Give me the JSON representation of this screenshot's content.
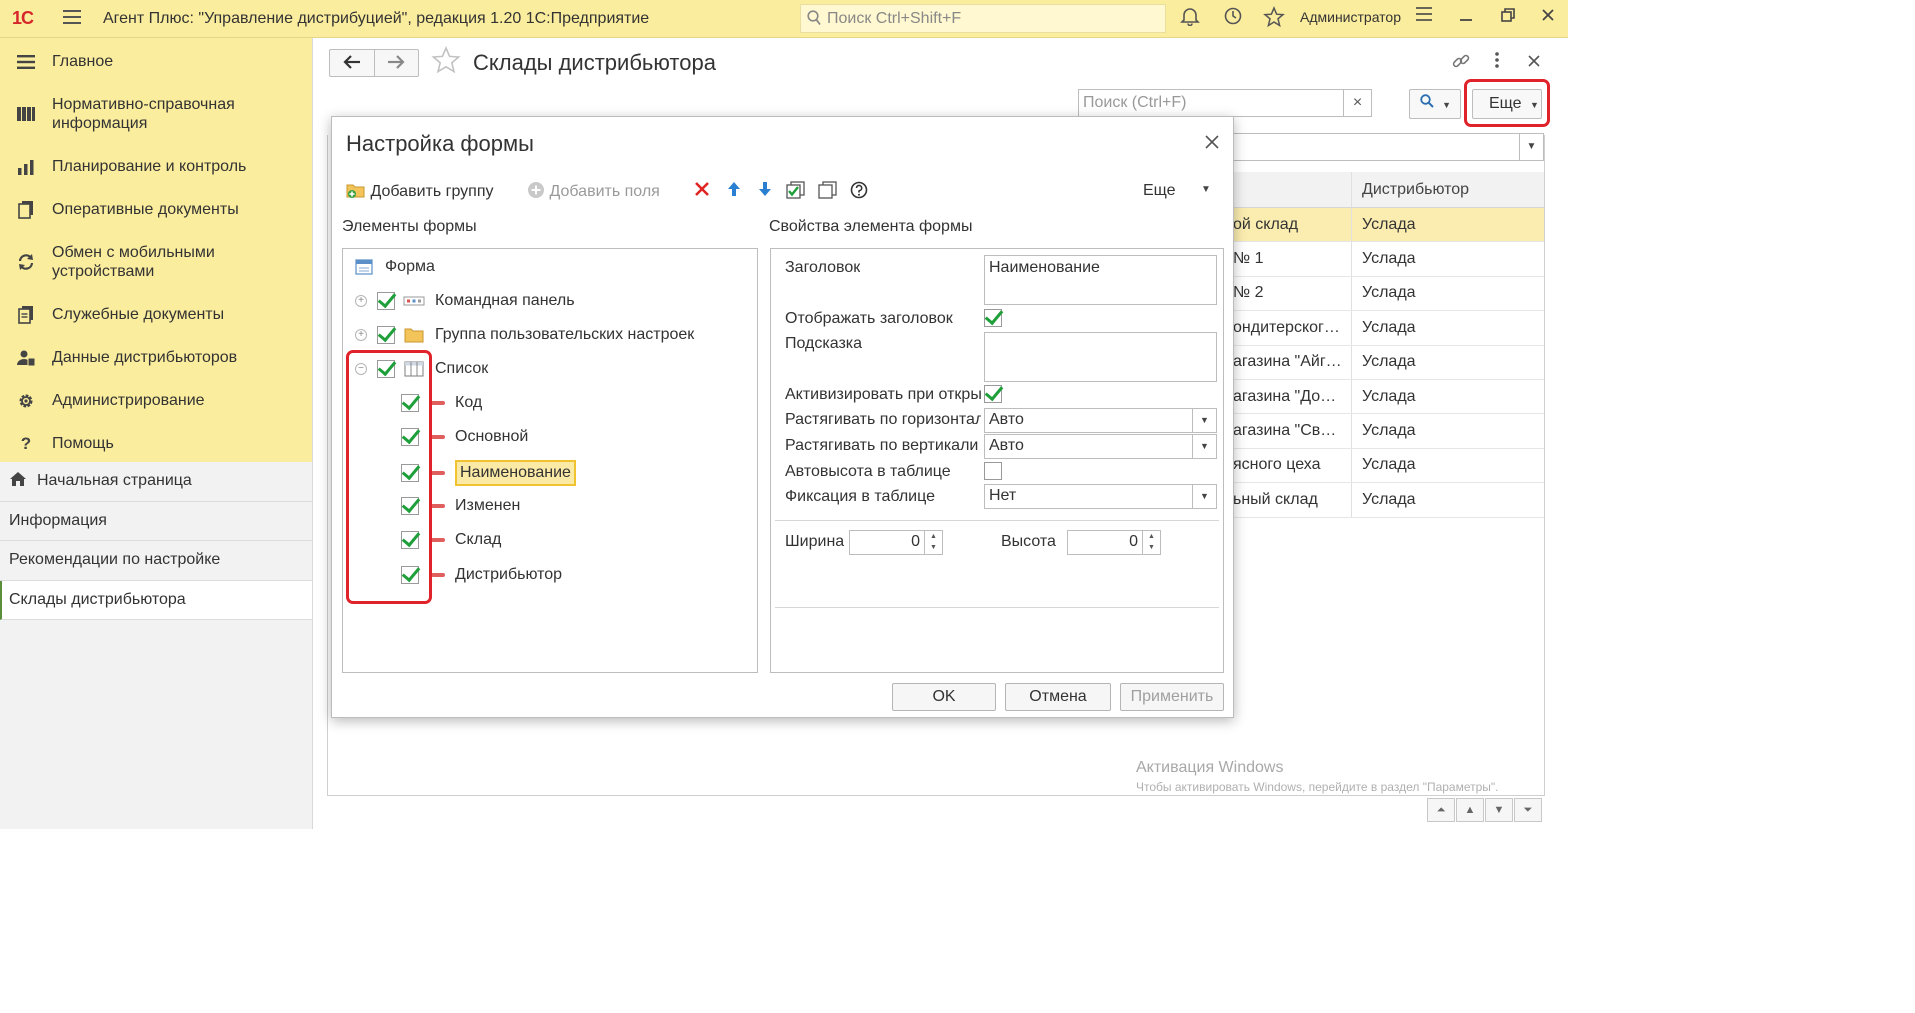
{
  "app": {
    "logo": "1С",
    "title": "Агент Плюс: \"Управление дистрибуцией\", редакция 1.20 1С:Предприятие",
    "search_placeholder": "Поиск Ctrl+Shift+F",
    "user": "Администратор"
  },
  "sections": [
    {
      "label": "Главное",
      "icon": "hamburger-icon"
    },
    {
      "label": "Нормативно-справочная информация",
      "icon": "catalog-icon"
    },
    {
      "label": "Планирование и контроль",
      "icon": "chart-icon"
    },
    {
      "label": "Оперативные документы",
      "icon": "documents-icon"
    },
    {
      "label": "Обмен с мобильными устройствами",
      "icon": "sync-icon"
    },
    {
      "label": "Служебные документы",
      "icon": "service-docs-icon"
    },
    {
      "label": "Данные дистрибьюторов",
      "icon": "distributor-data-icon"
    },
    {
      "label": "Администрирование",
      "icon": "gear-icon"
    },
    {
      "label": "Помощь",
      "icon": "question-icon"
    }
  ],
  "nav": [
    {
      "label": "Начальная страница"
    },
    {
      "label": "Информация"
    },
    {
      "label": "Рекомендации по настройке"
    },
    {
      "label": "Склады дистрибьютора"
    }
  ],
  "page": {
    "title": "Склады дистрибьютора",
    "search_placeholder": "Поиск (Ctrl+F)",
    "more_label": "Еще",
    "column_distributor": "Дистрибьютор",
    "rows": [
      {
        "name": "ой склад",
        "distributor": "Услада"
      },
      {
        "name": "№ 1",
        "distributor": "Услада"
      },
      {
        "name": "№ 2",
        "distributor": "Услада"
      },
      {
        "name": "ондитерског…",
        "distributor": "Услада"
      },
      {
        "name": "агазина \"Айг…",
        "distributor": "Услада"
      },
      {
        "name": "агазина \"До…",
        "distributor": "Услада"
      },
      {
        "name": "агазина \"Св…",
        "distributor": "Услада"
      },
      {
        "name": "ясного цеха",
        "distributor": "Услада"
      },
      {
        "name": "ьный склад",
        "distributor": "Услада"
      }
    ]
  },
  "watermark": {
    "title": "Активация Windows",
    "subtitle": "Чтобы активировать Windows, перейдите в раздел \"Параметры\"."
  },
  "dialog": {
    "title": "Настройка формы",
    "toolbar": {
      "add_group": "Добавить группу",
      "add_fields": "Добавить поля",
      "more": "Еще"
    },
    "elements_label": "Элементы формы",
    "properties_label": "Свойства элемента формы",
    "tree": {
      "root": "Форма",
      "command_panel": "Командная панель",
      "user_settings_group": "Группа пользовательских настроек",
      "list": "Список",
      "fields": [
        "Код",
        "Основной",
        "Наименование",
        "Изменен",
        "Склад",
        "Дистрибьютор"
      ]
    },
    "props": {
      "header_label": "Заголовок",
      "header_value": "Наименование",
      "show_header_label": "Отображать заголовок",
      "hint_label": "Подсказка",
      "activate_label": "Активизировать при откры",
      "stretch_h_label": "Растягивать по горизонтал",
      "stretch_h_value": "Авто",
      "stretch_v_label": "Растягивать по вертикали",
      "stretch_v_value": "Авто",
      "autoheight_label": "Автовысота в таблице",
      "fix_label": "Фиксация в таблице",
      "fix_value": "Нет",
      "width_label": "Ширина",
      "width_value": "0",
      "height_label": "Высота",
      "height_value": "0"
    },
    "buttons": {
      "ok": "OK",
      "cancel": "Отмена",
      "apply": "Применить"
    }
  },
  "colors": {
    "accent_yellow": "#fbed9e",
    "highlight_red": "#e0232a",
    "check_green": "#1f9f3a"
  }
}
